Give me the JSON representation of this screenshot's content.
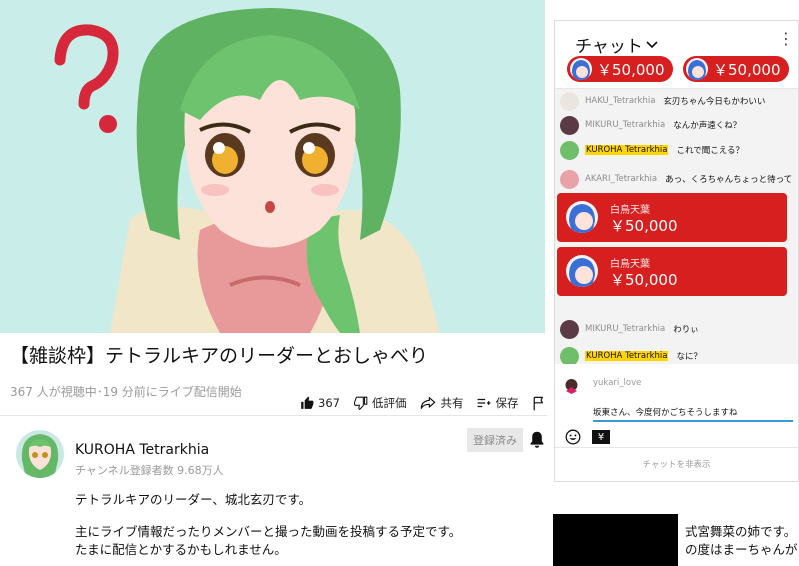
{
  "video": {
    "title": "【雑談枠】テトラルキアのリーダーとおしゃべり",
    "meta": "367 人が視聴中･19 分前にライブ配信開始",
    "actions": {
      "like_count": "367",
      "dislike_label": "低評価",
      "share_label": "共有",
      "save_label": "保存"
    }
  },
  "channel": {
    "name": "KUROHA Tetrarkhia",
    "subscribers": "チャンネル登録者数 9.68万人",
    "subscribe_label": "登録済み"
  },
  "description": [
    "テトラルキアのリーダー、城北玄刃です。",
    "",
    "主にライブ情報だったりメンバーと撮った動画を投稿する予定です。",
    "たまに配信とかするかもしれません。"
  ],
  "chat": {
    "title": "チャット",
    "tickers": [
      {
        "amount": "￥50,000"
      },
      {
        "amount": "￥50,000"
      }
    ],
    "messages": [
      {
        "author": "HAKU_Tetrarkhia",
        "text": "玄刃ちゃん今日もかわいい",
        "owner": false,
        "avatar_color": "#e8e6de"
      },
      {
        "author": "MIKURU_Tetrarkhia",
        "text": "なんか声遠くね？",
        "owner": false,
        "avatar_color": "#5a3a44"
      },
      {
        "author": "KUROHA Tetrarkhia",
        "text": "これで聞こえる？",
        "owner": true,
        "avatar_color": "#6fbf6a"
      },
      {
        "author": "AKARI_Tetrarkhia",
        "text": "あっ、くろちゃんちょっと待って",
        "owner": false,
        "avatar_color": "#e9a2a8"
      }
    ],
    "superchats": [
      {
        "name": "白鳥天葉",
        "amount": "￥50,000"
      },
      {
        "name": "白鳥天葉",
        "amount": "￥50,000"
      }
    ],
    "messages_after": [
      {
        "author": "MIKURU_Tetrarkhia",
        "text": "わりぃ",
        "owner": false,
        "avatar_color": "#5a3a44"
      },
      {
        "author": "KUROHA Tetrarkhia",
        "text": "なに？",
        "owner": true,
        "avatar_color": "#6fbf6a"
      }
    ],
    "input": {
      "user": "yukari_love",
      "value": "坂東さん、今度何かごちそうしますね"
    },
    "yen_label": "¥",
    "hide_label": "チャットを非表示"
  },
  "related": {
    "lines": [
      "式宮舞菜の姉です。",
      "の度はまーちゃんが"
    ]
  },
  "colors": {
    "superchat_red": "#d71f1f",
    "owner_badge": "#ffd600",
    "video_bg": "#c9eeea"
  }
}
